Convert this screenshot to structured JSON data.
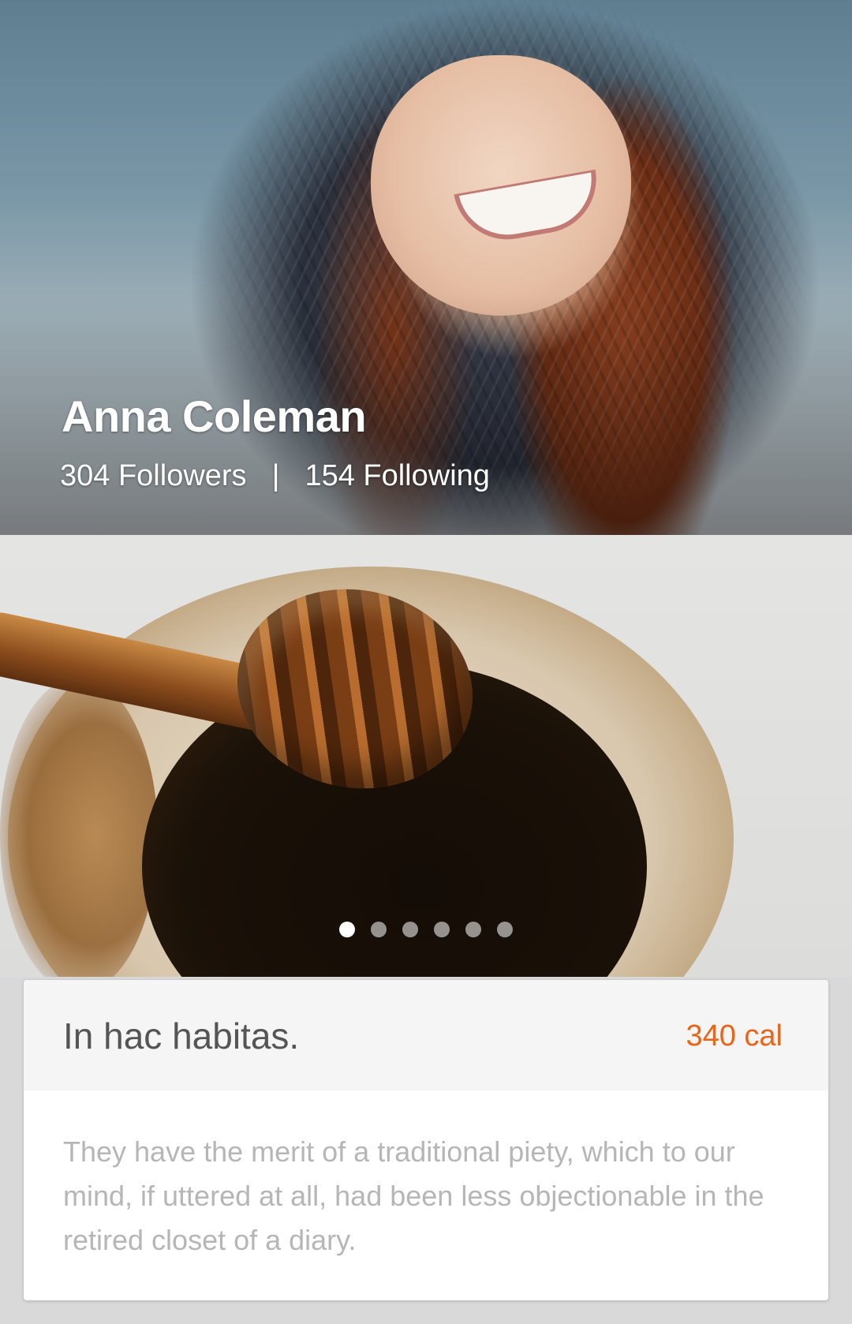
{
  "profile": {
    "name": "Anna Coleman",
    "followers": "304 Followers",
    "separator": "|",
    "following": "154 Following"
  },
  "slider": {
    "dot_count": 6,
    "active_index": 0
  },
  "card": {
    "title": "In hac habitas.",
    "calories": "340 cal",
    "description": "They have the merit of a traditional piety, which to our mind, if uttered at all, had been less objectionable in the retired closet of a diary.",
    "accent_color": "#e8651a"
  }
}
